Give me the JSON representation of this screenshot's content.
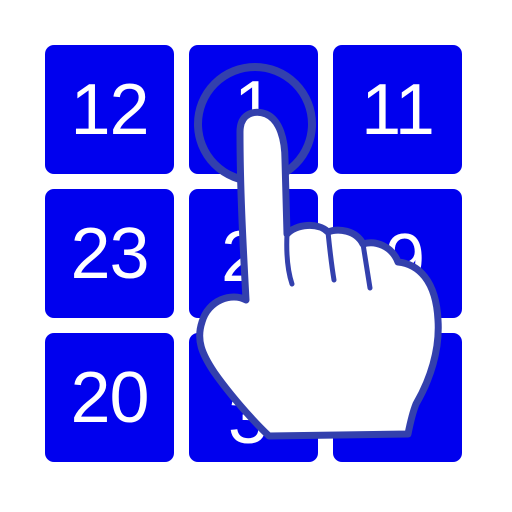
{
  "tiles": [
    "12",
    "1",
    "11",
    "23",
    "2",
    "9",
    "20",
    "3",
    ""
  ],
  "icons": {
    "cursor": "pointing-hand-icon",
    "tap": "tap-ripple-icon"
  },
  "colors": {
    "tile": "#0000ee",
    "tile_text": "#ffffff",
    "hand_outline": "#3340ad",
    "background": "#ffffff"
  }
}
